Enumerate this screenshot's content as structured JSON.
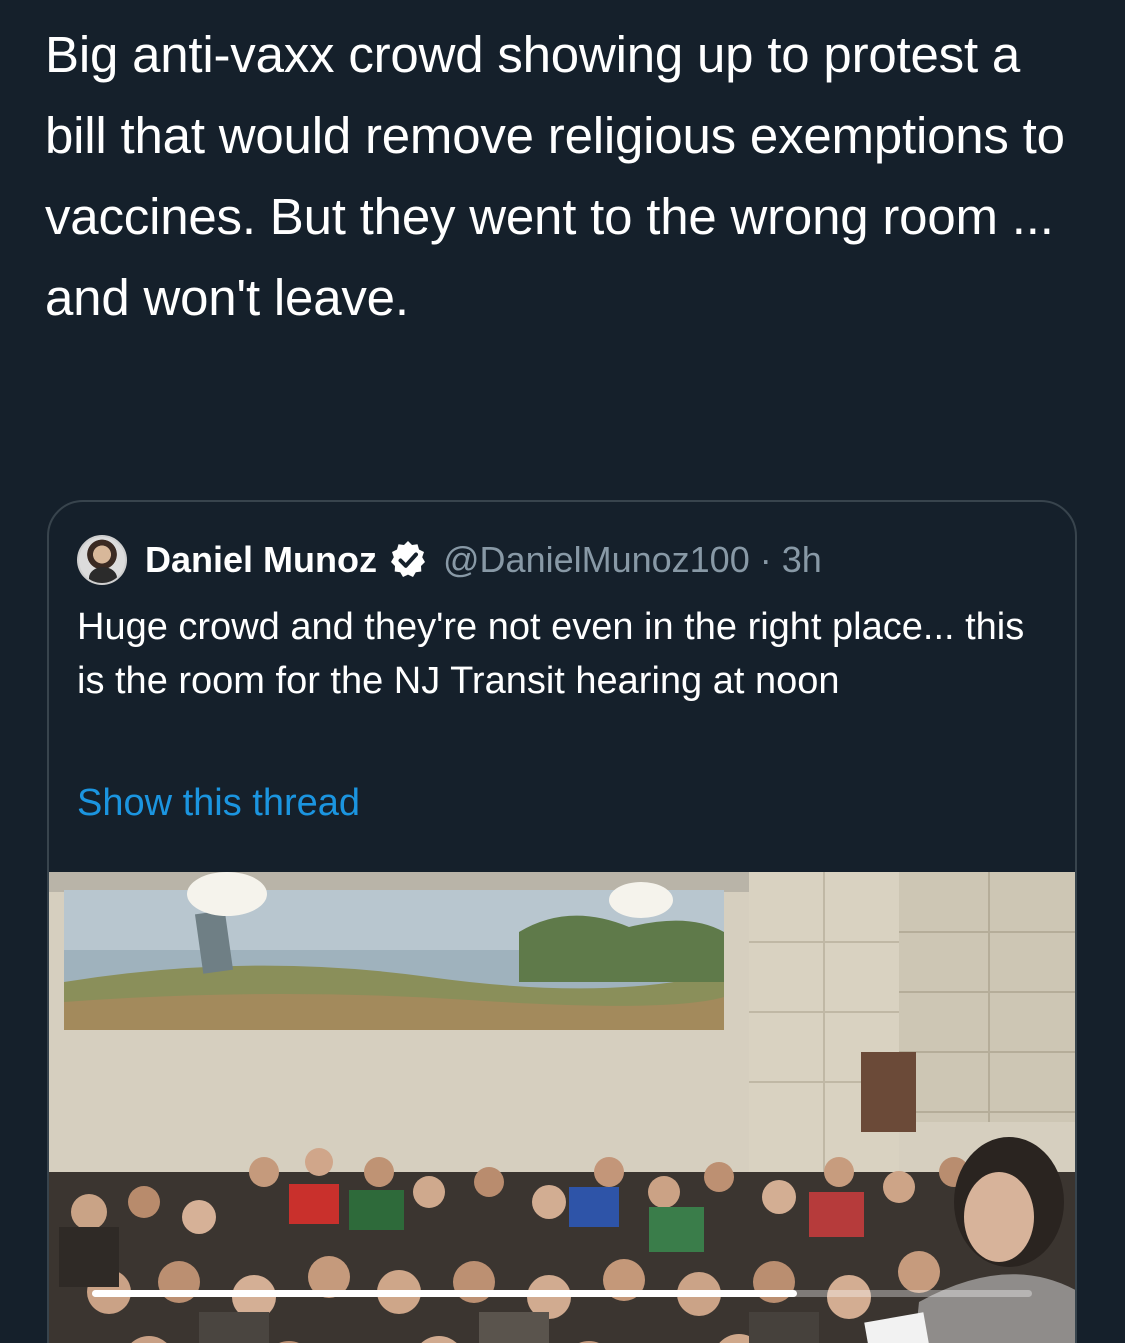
{
  "tweet": {
    "text": "Big anti-vaxx crowd showing up to protest a bill that would remove religious exemptions to vaccines. But they went to the wrong room ... and won't leave."
  },
  "quoted_tweet": {
    "display_name": "Daniel Munoz",
    "handle": "@DanielMunoz100",
    "separator": "·",
    "time": "3h",
    "text": "Huge crowd and they're not even in the right place... this is the room for the NJ Transit hearing at noon",
    "show_thread": "Show this thread",
    "verified_icon": "verified-badge-icon",
    "media": {
      "type": "video",
      "progress": 0.75
    }
  },
  "colors": {
    "background": "#15202b",
    "text": "#ffffff",
    "secondary": "#8899a6",
    "link": "#1b95e0",
    "border": "#38444d"
  }
}
